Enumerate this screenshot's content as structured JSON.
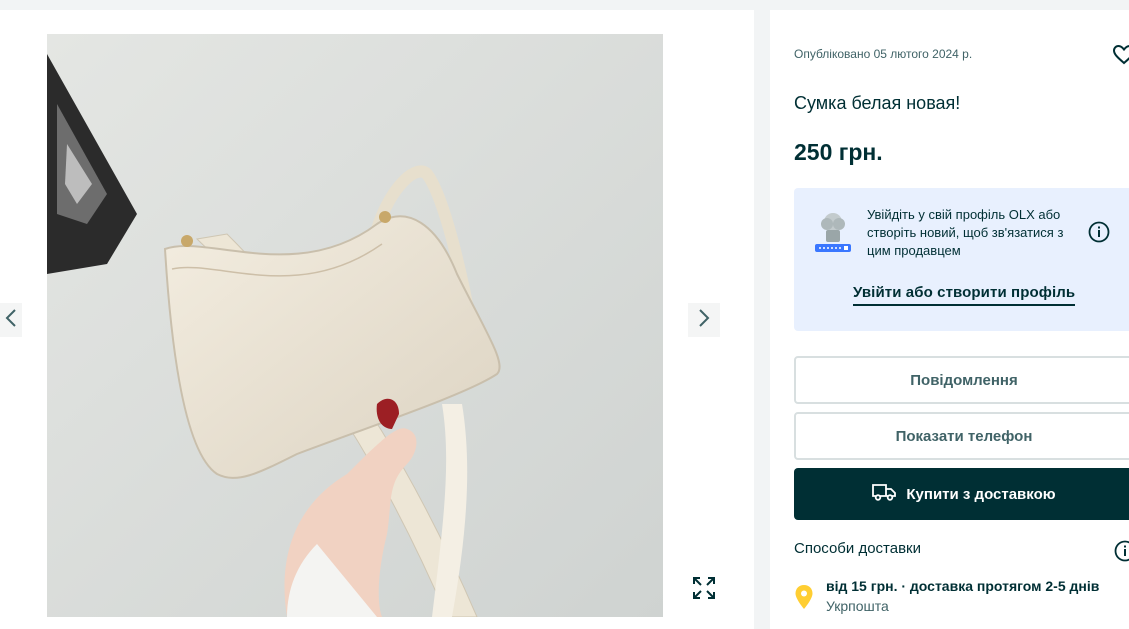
{
  "listing": {
    "posted": "Опубліковано 05 лютого 2024 р.",
    "title": "Сумка белая новая!",
    "price": "250 грн."
  },
  "login_prompt": {
    "text": "Увійдіть у свій профіль OLX або створіть новий, щоб зв'язатися з цим продавцем",
    "link": "Увійти або створити профіль"
  },
  "actions": {
    "message": "Повідомлення",
    "phone": "Показати телефон",
    "buy": "Купити з доставкою"
  },
  "delivery": {
    "heading": "Способи доставки",
    "line": "від 15 грн. · доставка протягом 2-5 днів",
    "carrier": "Укрпошта"
  },
  "icons": {
    "prev": "chevron-left-icon",
    "next": "chevron-right-icon",
    "fullscreen": "expand-icon",
    "favorite": "heart-icon",
    "info": "info-icon",
    "truck": "truck-icon",
    "location": "location-pin-icon"
  },
  "colors": {
    "brand_dark": "#002f34",
    "muted": "#406367",
    "info_bg": "#e8f0fe",
    "pin": "#ffce32"
  }
}
